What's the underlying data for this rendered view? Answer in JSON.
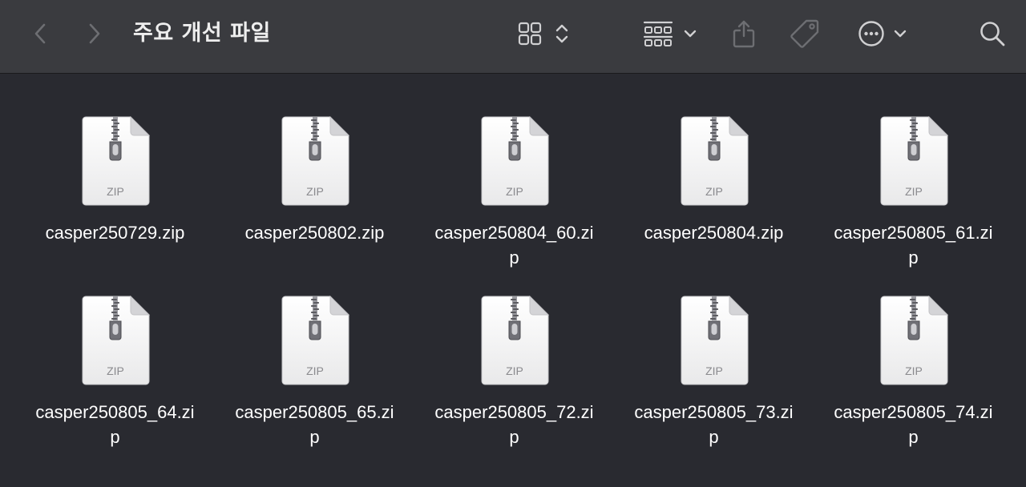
{
  "window": {
    "title": "주요 개선 파일"
  },
  "toolbar": {
    "back_icon": "chevron-left-icon",
    "forward_icon": "chevron-right-icon",
    "view_icon": "grid-view-icon",
    "group_icon": "group-by-icon",
    "share_icon": "share-icon",
    "tag_icon": "tag-icon",
    "more_icon": "ellipsis-circle-icon",
    "search_icon": "search-icon"
  },
  "colors": {
    "background": "#292a30",
    "toolbar": "#3a3b3f",
    "text": "#ffffff"
  },
  "files": [
    {
      "name": "casper250729.zip",
      "type_label": "ZIP"
    },
    {
      "name": "casper250802.zip",
      "type_label": "ZIP"
    },
    {
      "name": "casper250804_60.zip",
      "type_label": "ZIP"
    },
    {
      "name": "casper250804.zip",
      "type_label": "ZIP"
    },
    {
      "name": "casper250805_61.zip",
      "type_label": "ZIP"
    },
    {
      "name": "casper250805_64.zip",
      "type_label": "ZIP"
    },
    {
      "name": "casper250805_65.zip",
      "type_label": "ZIP"
    },
    {
      "name": "casper250805_72.zip",
      "type_label": "ZIP"
    },
    {
      "name": "casper250805_73.zip",
      "type_label": "ZIP"
    },
    {
      "name": "casper250805_74.zip",
      "type_label": "ZIP"
    }
  ]
}
